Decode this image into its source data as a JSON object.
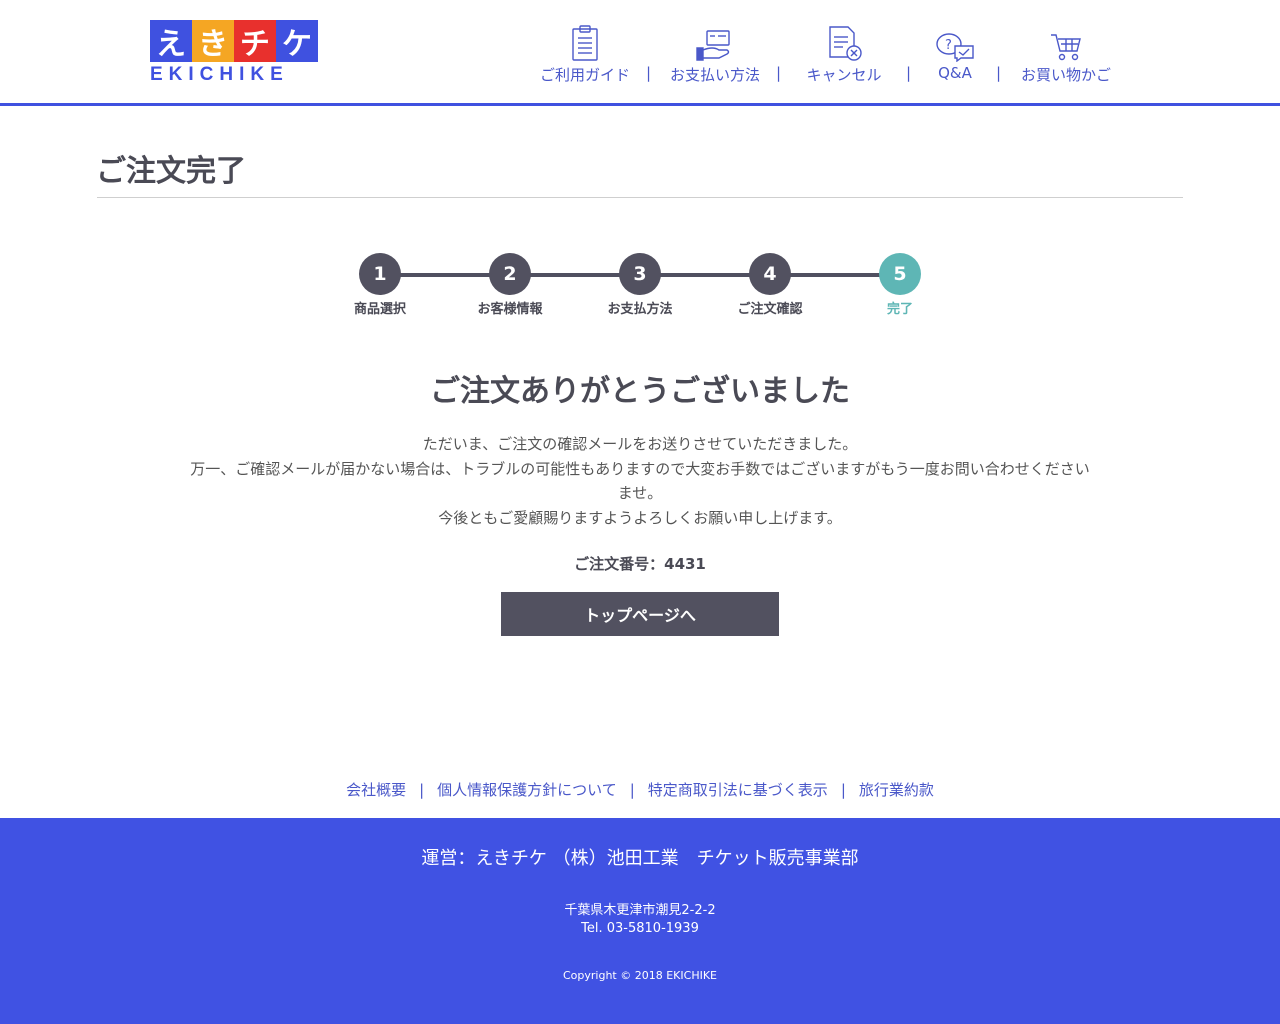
{
  "brand": {
    "logo_chars": [
      "え",
      "き",
      "チ",
      "ケ"
    ],
    "logo_colors": [
      "#3f51e0",
      "#f5a623",
      "#e8302d",
      "#3f51e0"
    ],
    "logo_text": "EKICHIKE",
    "accent": "#3f51e0"
  },
  "nav": {
    "items": [
      {
        "label": "ご利用ガイド",
        "icon": "clipboard-icon"
      },
      {
        "label": "お支払い方法",
        "icon": "card-hand-icon"
      },
      {
        "label": "キャンセル",
        "icon": "document-cancel-icon"
      },
      {
        "label": "Q&A",
        "icon": "chat-question-icon"
      },
      {
        "label": "お買い物かご",
        "icon": "cart-icon"
      }
    ],
    "separator": "|"
  },
  "page": {
    "title": "ご注文完了"
  },
  "steps": {
    "items": [
      {
        "number": "1",
        "label": "商品選択"
      },
      {
        "number": "2",
        "label": "お客様情報"
      },
      {
        "number": "3",
        "label": "お支払方法"
      },
      {
        "number": "4",
        "label": "ご注文確認"
      },
      {
        "number": "5",
        "label": "完了"
      }
    ],
    "active_index": 4,
    "active_color": "#5eb6b5"
  },
  "thanks": {
    "title": "ご注文ありがとうございました",
    "line1": "ただいま、ご注文の確認メールをお送りさせていただきました。",
    "line2": "万一、ご確認メールが届かない場合は、トラブルの可能性もありますので大変お手数ではございますがもう一度お問い合わせくださいませ。",
    "line3": "今後ともご愛顧賜りますようよろしくお願い申し上げます。",
    "order_number": "ご注文番号：4431",
    "button": "トップページへ"
  },
  "footer_links": {
    "items": [
      "会社概要",
      "個人情報保護方針について",
      "特定商取引法に基づく表示",
      "旅行業約款"
    ],
    "separator": "|"
  },
  "footer": {
    "company": "運営：えきチケ （株）池田工業　チケット販売事業部",
    "address": "千葉県木更津市潮見2-2-2",
    "tel": "Tel. 03-5810-1939",
    "copyright": "Copyright © 2018 EKICHIKE",
    "bg_color": "#4052e3"
  }
}
